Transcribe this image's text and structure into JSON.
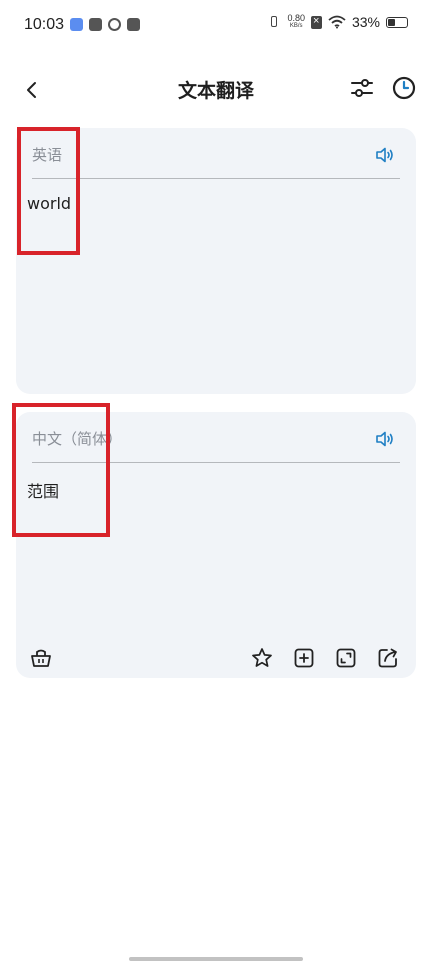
{
  "status_bar": {
    "time": "10:03",
    "net_speed_value": "0.80",
    "net_speed_unit": "KB/s",
    "battery_percent": "33%"
  },
  "header": {
    "title": "文本翻译"
  },
  "source_panel": {
    "language": "英语",
    "text": "world"
  },
  "target_panel": {
    "language": "中文（简体）",
    "text": "范围"
  },
  "colors": {
    "accent": "#1f7fc4",
    "card_background": "#f1f4f8",
    "highlight": "#d8232a"
  },
  "icons": {
    "back": "chevron-left-icon",
    "settings": "sliders-icon",
    "history": "clock-icon",
    "speak": "speaker-icon",
    "clear": "basket-icon",
    "favorite": "star-icon",
    "add": "plus-square-icon",
    "fullscreen": "expand-icon",
    "share": "share-icon"
  }
}
